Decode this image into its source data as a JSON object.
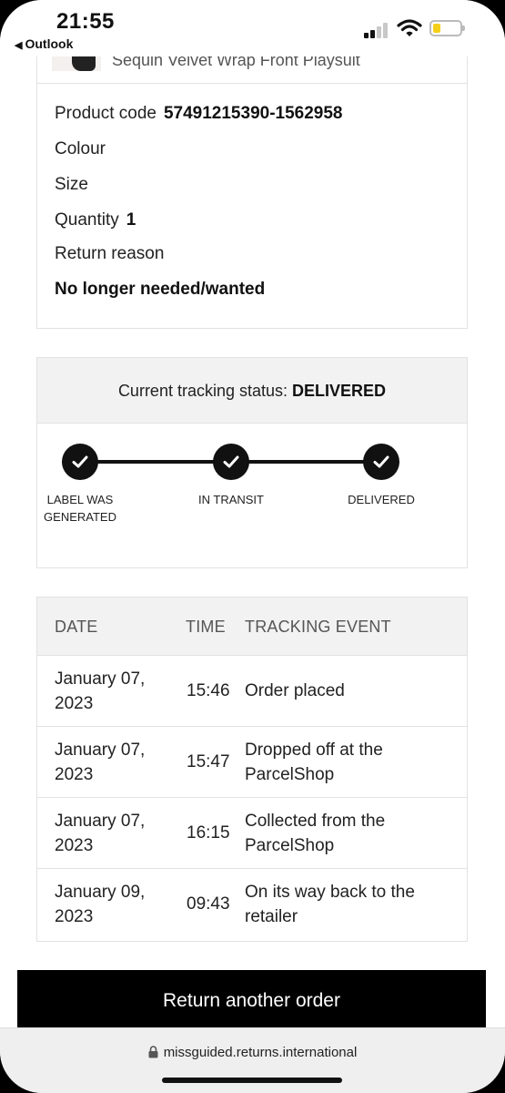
{
  "status_bar": {
    "time": "21:55",
    "back_app": "Outlook",
    "battery_color": "#f5cf1a"
  },
  "product": {
    "name": "Sequin Velvet Wrap Front Playsuit",
    "code_label": "Product code",
    "code_value": "57491215390-1562958",
    "colour_label": "Colour",
    "size_label": "Size",
    "quantity_label": "Quantity",
    "quantity_value": "1",
    "return_reason_label": "Return reason",
    "return_reason_value": "No longer needed/wanted"
  },
  "tracking": {
    "status_label": "Current tracking status:",
    "status_value": "DELIVERED",
    "steps": [
      {
        "label_line1": "LABEL WAS",
        "label_line2": "GENERATED",
        "done": true
      },
      {
        "label_line1": "IN TRANSIT",
        "label_line2": "",
        "done": true
      },
      {
        "label_line1": "DELIVERED",
        "label_line2": "",
        "done": true
      }
    ]
  },
  "events_table": {
    "headers": [
      "DATE",
      "TIME",
      "TRACKING EVENT"
    ],
    "rows": [
      {
        "date_line1": "January 07,",
        "date_line2": "2023",
        "time": "15:46",
        "event_line1": "Order placed",
        "event_line2": ""
      },
      {
        "date_line1": "January 07,",
        "date_line2": "2023",
        "time": "15:47",
        "event_line1": "Dropped off at the",
        "event_line2": "ParcelShop"
      },
      {
        "date_line1": "January 07,",
        "date_line2": "2023",
        "time": "16:15",
        "event_line1": "Collected from the",
        "event_line2": "ParcelShop"
      },
      {
        "date_line1": "January 09,",
        "date_line2": "2023",
        "time": "09:43",
        "event_line1": "On its way back to the",
        "event_line2": "retailer"
      }
    ]
  },
  "cta": {
    "label": "Return another order"
  },
  "browser": {
    "url": "missguided.returns.international"
  }
}
